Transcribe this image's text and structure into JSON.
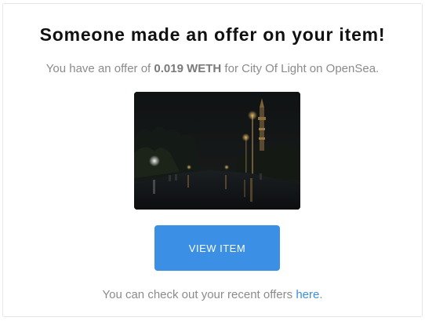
{
  "email": {
    "title": "Someone made an offer on your item!",
    "offer_prefix": "You have an offer of ",
    "offer_amount": "0.019 WETH",
    "offer_suffix": " for City Of Light on OpenSea.",
    "image_subject": "night city street with lit tower",
    "button_label": "VIEW ITEM",
    "footer_prefix": "You can check out your recent offers ",
    "footer_link": "here",
    "footer_suffix": "."
  },
  "colors": {
    "button": "#3b90e6",
    "link": "#3b8fe0",
    "muted_text": "#8b8b8b",
    "title_text": "#111111"
  }
}
